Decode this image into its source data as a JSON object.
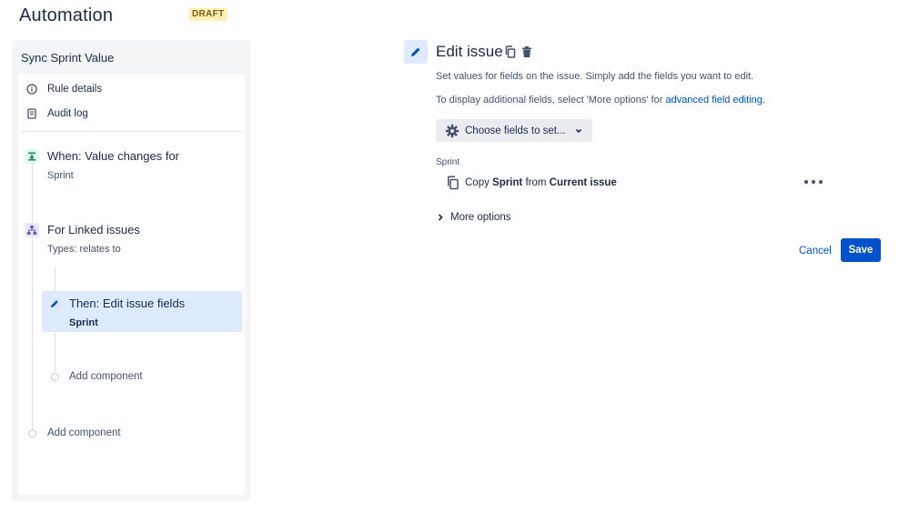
{
  "header": {
    "title": "Automation",
    "badge": "DRAFT"
  },
  "rule": {
    "name": "Sync Sprint Value",
    "menu": [
      {
        "label": "Rule details",
        "icon": "info-icon"
      },
      {
        "label": "Audit log",
        "icon": "audit-log-icon"
      }
    ],
    "trigger": {
      "title": "When: Value changes for",
      "detail": "Sprint",
      "icon": "field-change-icon",
      "color": "#00875a"
    },
    "branch": {
      "title": "For Linked issues",
      "detail": "Types: relates to",
      "icon": "branch-icon",
      "color": "#6554c0"
    },
    "action": {
      "title": "Then: Edit issue fields",
      "detail": "Sprint",
      "icon": "pencil-icon",
      "color": "#0052cc"
    },
    "add_component_inner": "Add component",
    "add_component_outer": "Add component"
  },
  "editor": {
    "title": "Edit issue",
    "description": "Set values for fields on the issue. Simply add the fields you want to edit.",
    "additional_prefix": "To display additional fields, select 'More options' for ",
    "additional_link": "advanced field editing",
    "additional_suffix": ".",
    "choose_fields_label": "Choose fields to set...",
    "field_label": "Sprint",
    "field_value": {
      "prefix": "Copy ",
      "field": "Sprint",
      "middle": " from ",
      "source": "Current issue"
    },
    "more_options_label": "More options",
    "cancel_label": "Cancel",
    "save_label": "Save"
  },
  "colors": {
    "accent": "#0052cc",
    "selected_bg": "#deebff",
    "panel_bg": "#f4f5f7",
    "badge_bg": "#fff0b3"
  }
}
